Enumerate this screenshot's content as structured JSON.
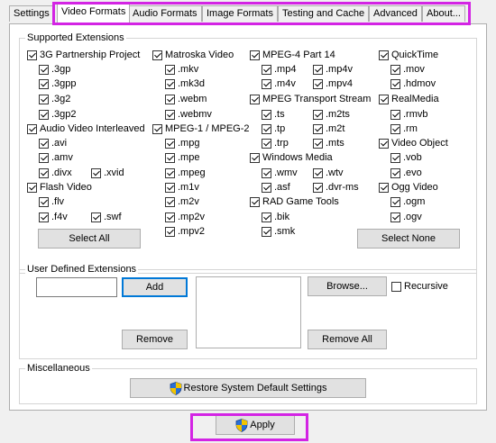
{
  "tabs": [
    {
      "label": "Settings"
    },
    {
      "label": "Video Formats"
    },
    {
      "label": "Audio Formats"
    },
    {
      "label": "Image Formats"
    },
    {
      "label": "Testing and Cache"
    },
    {
      "label": "Advanced"
    },
    {
      "label": "About..."
    }
  ],
  "supported": {
    "title": "Supported Extensions",
    "col1": [
      {
        "label": "3G Partnership Project",
        "checked": true
      },
      {
        "label": ".3gp",
        "checked": true
      },
      {
        "label": ".3gpp",
        "checked": true
      },
      {
        "label": ".3g2",
        "checked": true
      },
      {
        "label": ".3gp2",
        "checked": true
      },
      {
        "label": "Audio Video Interleaved",
        "checked": true
      },
      {
        "label": ".avi",
        "checked": true
      },
      {
        "label": ".amv",
        "checked": true
      },
      {
        "label": ".divx",
        "checked": true
      },
      {
        "label": ".xvid",
        "checked": true
      },
      {
        "label": "Flash Video",
        "checked": true
      },
      {
        "label": ".flv",
        "checked": true
      },
      {
        "label": ".f4v",
        "checked": true
      },
      {
        "label": ".swf",
        "checked": true
      }
    ],
    "col2": [
      {
        "label": "Matroska Video",
        "checked": true
      },
      {
        "label": ".mkv",
        "checked": true
      },
      {
        "label": ".mk3d",
        "checked": true
      },
      {
        "label": ".webm",
        "checked": true
      },
      {
        "label": ".webmv",
        "checked": true
      },
      {
        "label": "MPEG-1 / MPEG-2",
        "checked": true
      },
      {
        "label": ".mpg",
        "checked": true
      },
      {
        "label": ".mpe",
        "checked": true
      },
      {
        "label": ".mpeg",
        "checked": true
      },
      {
        "label": ".m1v",
        "checked": true
      },
      {
        "label": ".m2v",
        "checked": true
      },
      {
        "label": ".mp2v",
        "checked": true
      },
      {
        "label": ".mpv2",
        "checked": true
      }
    ],
    "col3": [
      {
        "label": "MPEG-4 Part 14",
        "checked": true
      },
      {
        "label": ".mp4",
        "checked": true
      },
      {
        "label": ".mp4v",
        "checked": true
      },
      {
        "label": ".m4v",
        "checked": true
      },
      {
        "label": ".mpv4",
        "checked": true
      },
      {
        "label": "MPEG Transport Stream",
        "checked": true
      },
      {
        "label": ".ts",
        "checked": true
      },
      {
        "label": ".m2ts",
        "checked": true
      },
      {
        "label": ".tp",
        "checked": true
      },
      {
        "label": ".m2t",
        "checked": true
      },
      {
        "label": ".trp",
        "checked": true
      },
      {
        "label": ".mts",
        "checked": true
      },
      {
        "label": "Windows Media",
        "checked": true
      },
      {
        "label": ".wmv",
        "checked": true
      },
      {
        "label": ".wtv",
        "checked": true
      },
      {
        "label": ".asf",
        "checked": true
      },
      {
        "label": ".dvr-ms",
        "checked": true
      },
      {
        "label": "RAD Game Tools",
        "checked": true
      },
      {
        "label": ".bik",
        "checked": true
      },
      {
        "label": ".smk",
        "checked": true
      }
    ],
    "col4": [
      {
        "label": "QuickTime",
        "checked": true
      },
      {
        "label": ".mov",
        "checked": true
      },
      {
        "label": ".hdmov",
        "checked": true
      },
      {
        "label": "RealMedia",
        "checked": true
      },
      {
        "label": ".rmvb",
        "checked": true
      },
      {
        "label": ".rm",
        "checked": true
      },
      {
        "label": "Video Object",
        "checked": true
      },
      {
        "label": ".vob",
        "checked": true
      },
      {
        "label": ".evo",
        "checked": true
      },
      {
        "label": "Ogg Video",
        "checked": true
      },
      {
        "label": ".ogm",
        "checked": true
      },
      {
        "label": ".ogv",
        "checked": true
      }
    ],
    "select_all": "Select All",
    "select_none": "Select None"
  },
  "user_defined": {
    "title": "User Defined Extensions",
    "input_value": "",
    "add": "Add",
    "browse": "Browse...",
    "recursive": "Recursive",
    "recursive_checked": false,
    "remove": "Remove",
    "remove_all": "Remove All"
  },
  "misc": {
    "title": "Miscellaneous",
    "restore": "Restore System Default Settings"
  },
  "apply": "Apply",
  "colors": {
    "highlight": "#d324e4",
    "focus": "#0078d7"
  }
}
